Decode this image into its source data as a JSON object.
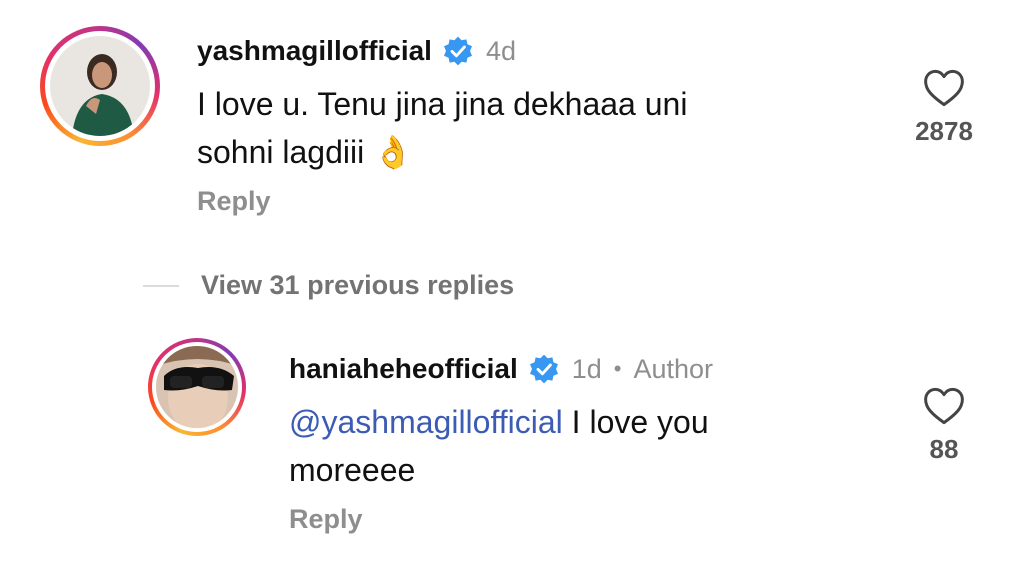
{
  "comment1": {
    "username": "yashmagillofficial",
    "time": "4d",
    "text_line1": "I love u. Tenu jina jina dekhaaa uni",
    "text_line2": "sohni lagdiii ",
    "emoji": "👌",
    "reply_label": "Reply",
    "like_count": "2878",
    "verified_icon": "verified-badge-icon",
    "like_icon": "heart-outline-icon"
  },
  "view_replies": {
    "label": "View 31 previous replies"
  },
  "comment2": {
    "username": "haniaheheofficial",
    "time": "1d",
    "separator": "•",
    "author_label": "Author",
    "mention": "@yashmagillofficial",
    "text_rest": " I love you",
    "text_line2": "moreeee",
    "reply_label": "Reply",
    "like_count": "88",
    "verified_icon": "verified-badge-icon",
    "like_icon": "heart-outline-icon"
  },
  "colors": {
    "verified": "#3897f0",
    "mention": "#3b5bb5",
    "muted": "#8e8e8e"
  }
}
